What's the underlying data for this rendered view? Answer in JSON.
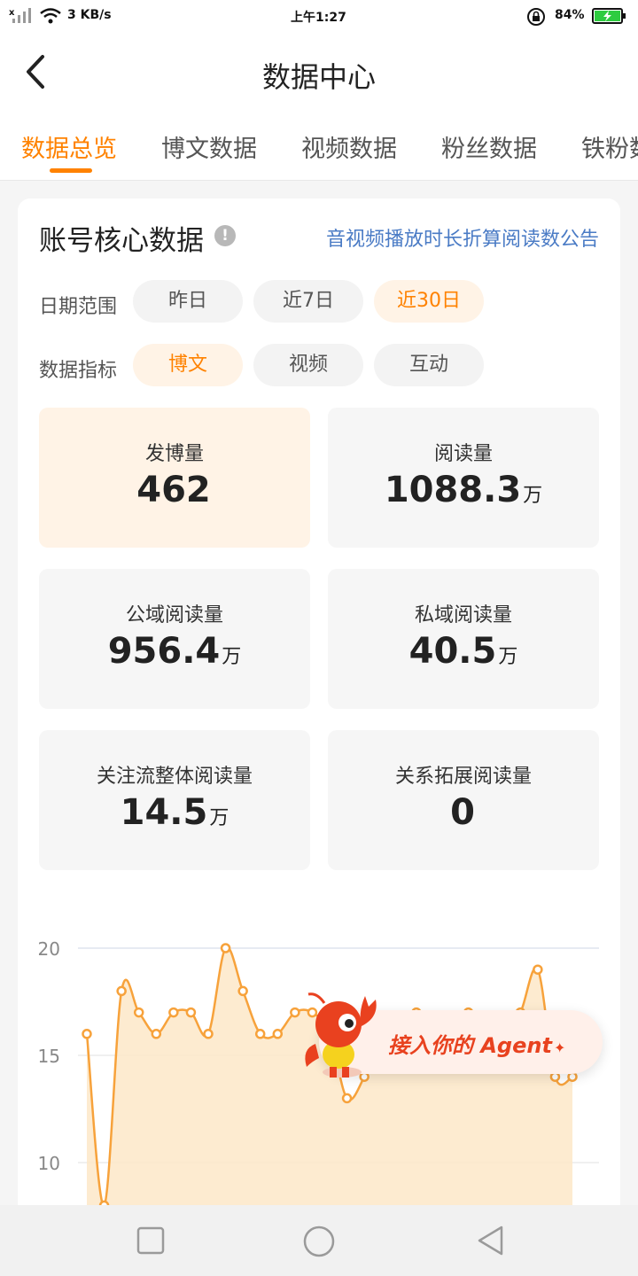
{
  "status_bar": {
    "network_speed": "3 KB/s",
    "time": "上午1:27",
    "battery": "84%",
    "icons": [
      "signal-icon",
      "wifi-icon",
      "rotation-lock-icon",
      "battery-icon"
    ]
  },
  "header": {
    "title": "数据中心",
    "back_icon": "back-arrow-icon"
  },
  "tabs": [
    {
      "label": "数据总览",
      "active": true
    },
    {
      "label": "博文数据",
      "active": false
    },
    {
      "label": "视频数据",
      "active": false
    },
    {
      "label": "粉丝数据",
      "active": false
    },
    {
      "label": "铁粉数据",
      "active": false
    }
  ],
  "core": {
    "title": "账号核心数据",
    "info_icon": "info-icon",
    "notice_link": "音视频播放时长折算阅读数公告",
    "date_range": {
      "label": "日期范围",
      "options": [
        "昨日",
        "近7日",
        "近30日"
      ],
      "selected": "近30日"
    },
    "metric": {
      "label": "数据指标",
      "options": [
        "博文",
        "视频",
        "互动"
      ],
      "selected": "博文"
    },
    "stats": [
      {
        "label": "发博量",
        "value": "462",
        "unit": "",
        "active": true
      },
      {
        "label": "阅读量",
        "value": "1088.3",
        "unit": "万",
        "active": false
      },
      {
        "label": "公域阅读量",
        "value": "956.4",
        "unit": "万",
        "active": false
      },
      {
        "label": "私域阅读量",
        "value": "40.5",
        "unit": "万",
        "active": false
      },
      {
        "label": "关注流整体阅读量",
        "value": "14.5",
        "unit": "万",
        "active": false
      },
      {
        "label": "关系拓展阅读量",
        "value": "0",
        "unit": "",
        "active": false
      }
    ]
  },
  "chart_data": {
    "type": "area",
    "title": "",
    "xlabel": "",
    "ylabel": "",
    "y_ticks": [
      "20",
      "15",
      "10"
    ],
    "ylim": [
      8,
      20
    ],
    "grid": true,
    "color": "#f7a23b",
    "series": [
      {
        "values": [
          16,
          8,
          18,
          17,
          16,
          17,
          17,
          16,
          20,
          18,
          16,
          16,
          17,
          17,
          16,
          13,
          14,
          16,
          16,
          17,
          16,
          16,
          17,
          16,
          16,
          17,
          19,
          14,
          14
        ]
      }
    ]
  },
  "agent_banner": {
    "text": "接入你的 Agent",
    "sparkle": "✦",
    "mascot": "lobster-mascot-icon"
  },
  "system_nav": {
    "icons": [
      "recent-apps-icon",
      "home-icon",
      "back-triangle-icon"
    ]
  }
}
